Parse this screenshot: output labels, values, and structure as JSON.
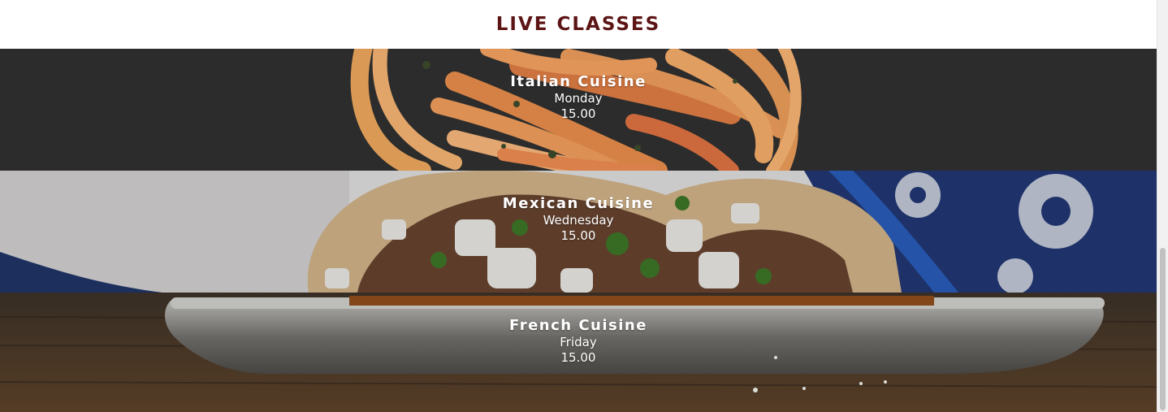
{
  "section": {
    "title": "LIVE CLASSES"
  },
  "classes": [
    {
      "name": "Italian Cuisine",
      "day": "Monday",
      "time": "15.00"
    },
    {
      "name": "Mexican Cuisine",
      "day": "Wednesday",
      "time": "15.00"
    },
    {
      "name": "French Cuisine",
      "day": "Friday",
      "time": "15.00"
    }
  ],
  "colors": {
    "title": "#5c1414",
    "text": "#ffffff",
    "italian_bg": "#2f2f2f",
    "mexican_bg": "#e8e6e6",
    "french_bg": "#3a2a1e"
  }
}
